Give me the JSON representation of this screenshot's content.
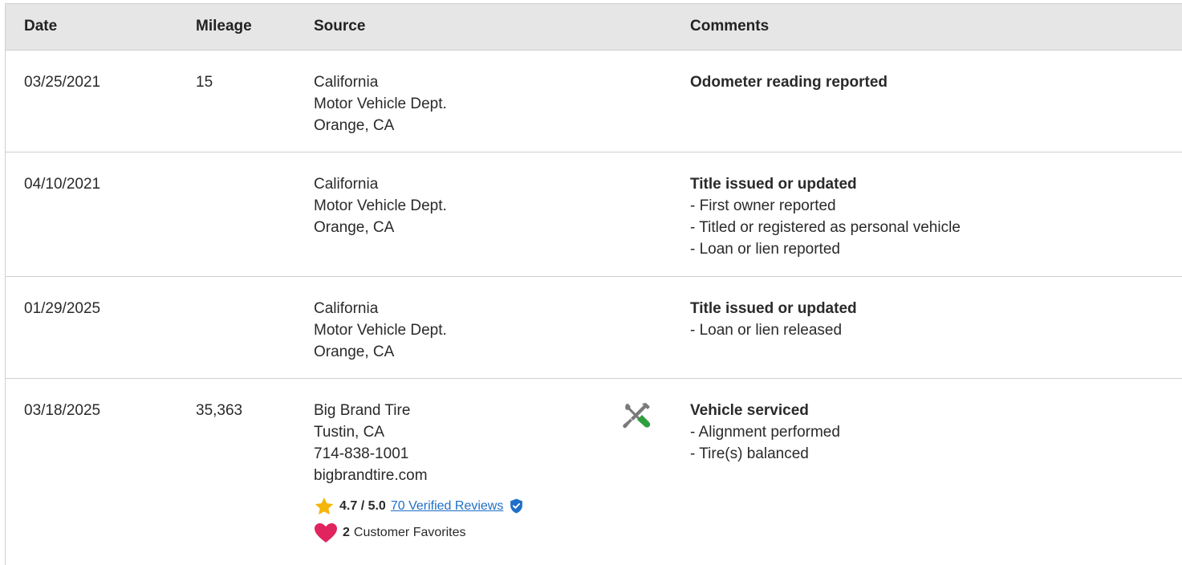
{
  "header": {
    "date": "Date",
    "mileage": "Mileage",
    "source": "Source",
    "comments": "Comments"
  },
  "rows": [
    {
      "date": "03/25/2021",
      "mileage": "15",
      "source": [
        "California",
        "Motor Vehicle Dept.",
        "Orange, CA"
      ],
      "comment_title": "Odometer reading reported",
      "comment_items": []
    },
    {
      "date": "04/10/2021",
      "mileage": "",
      "source": [
        "California",
        "Motor Vehicle Dept.",
        "Orange, CA"
      ],
      "comment_title": "Title issued or updated",
      "comment_items": [
        "- First owner reported",
        "- Titled or registered as personal vehicle",
        "- Loan or lien reported"
      ]
    },
    {
      "date": "01/29/2025",
      "mileage": "",
      "source": [
        "California",
        "Motor Vehicle Dept.",
        "Orange, CA"
      ],
      "comment_title": "Title issued or updated",
      "comment_items": [
        "- Loan or lien released"
      ]
    },
    {
      "date": "03/18/2025",
      "mileage": "35,363",
      "source": [
        "Big Brand Tire",
        "Tustin, CA",
        "714-838-1001",
        "bigbrandtire.com"
      ],
      "comment_title": "Vehicle serviced",
      "comment_items": [
        "- Alignment performed",
        "- Tire(s) balanced"
      ],
      "icon": "service-tools-icon",
      "rating": {
        "score": "4.7 / 5.0",
        "reviews_link": "70 Verified Reviews",
        "favorites_count": "2",
        "favorites_label": "Customer Favorites"
      }
    }
  ],
  "colors": {
    "header_bg": "#e6e6e6",
    "link": "#1e6fc7",
    "star": "#f5b50a",
    "heart": "#e0245e",
    "shield": "#1e6fc7",
    "wrench_green": "#2e9e3e"
  }
}
